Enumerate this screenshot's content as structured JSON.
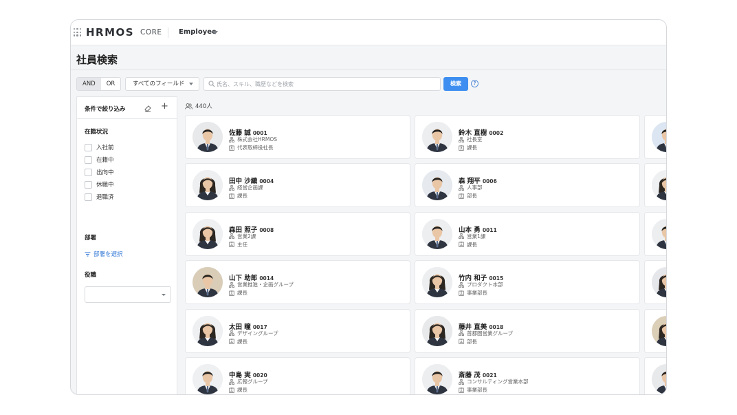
{
  "topbar": {
    "logo": "HRMOS",
    "logo_sub": "CORE",
    "app": "Employee"
  },
  "page": {
    "title": "社員検索"
  },
  "search": {
    "logic": [
      "AND",
      "OR"
    ],
    "field": "すべてのフィールド",
    "placeholder": "氏名、スキル、職歴などを検索",
    "button": "検索",
    "help": "?"
  },
  "sidebar": {
    "title": "条件で絞り込み",
    "status_title": "在籍状況",
    "statuses": [
      "入社前",
      "在籍中",
      "出向中",
      "休職中",
      "退職済"
    ],
    "dept_title": "部署",
    "dept_link": "部署を選択",
    "role_title": "役職"
  },
  "results": {
    "count": "440人",
    "employees": [
      {
        "name": "佐藤 誠",
        "id": "0001",
        "dept": "株式会社HRMOS",
        "role": "代表取締役社長",
        "gender": "m",
        "bg": "#e8e9eb"
      },
      {
        "name": "鈴木 直樹",
        "id": "0002",
        "dept": "社長室",
        "role": "課長",
        "gender": "m",
        "bg": "#eceef0"
      },
      {
        "name": "田中 沙織",
        "id": "0004",
        "dept": "経営企画課",
        "role": "課長",
        "gender": "f",
        "bg": "#eeeff1"
      },
      {
        "name": "森 翔平",
        "id": "0006",
        "dept": "人事部",
        "role": "部長",
        "gender": "m",
        "bg": "#e6eaef"
      },
      {
        "name": "森田 照子",
        "id": "0008",
        "dept": "営業2課",
        "role": "主任",
        "gender": "f",
        "bg": "#eef0f2"
      },
      {
        "name": "山本 勇",
        "id": "0011",
        "dept": "営業1課",
        "role": "課長",
        "gender": "m",
        "bg": "#eceef0"
      },
      {
        "name": "山下 助郎",
        "id": "0014",
        "dept": "営業推進・企画グループ",
        "role": "課長",
        "gender": "m",
        "bg": "#d9cdb8"
      },
      {
        "name": "竹内 和子",
        "id": "0015",
        "dept": "プロダクト本部",
        "role": "事業部長",
        "gender": "f",
        "bg": "#eceef0"
      },
      {
        "name": "太田 瞳",
        "id": "0017",
        "dept": "デザイングループ",
        "role": "課長",
        "gender": "f",
        "bg": "#eef0f2"
      },
      {
        "name": "藤井 直美",
        "id": "0018",
        "dept": "首都圏営業グループ",
        "role": "部長",
        "gender": "f",
        "bg": "#e8e9eb"
      },
      {
        "name": "中島 実",
        "id": "0020",
        "dept": "広報グループ",
        "role": "課長",
        "gender": "m",
        "bg": "#eef0f2"
      },
      {
        "name": "斎藤 茂",
        "id": "0021",
        "dept": "コンサルティング営業本部",
        "role": "事業部長",
        "gender": "m",
        "bg": "#eceef0"
      }
    ]
  },
  "colors": {
    "accent": "#3d8ef0",
    "link": "#3d7fd8"
  }
}
